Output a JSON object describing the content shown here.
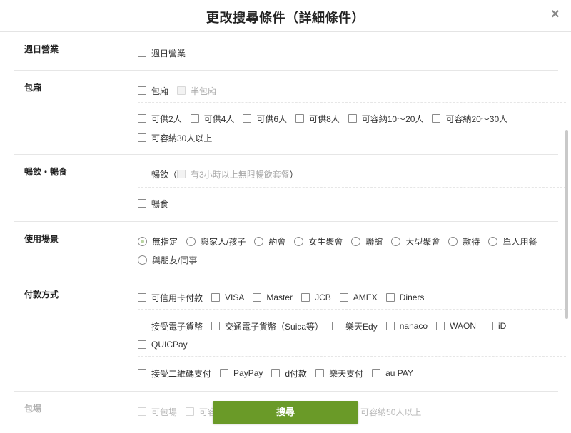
{
  "header": {
    "title": "更改搜尋條件（詳細條件）",
    "close_icon": "×"
  },
  "sections": {
    "weekday": {
      "label": "週日營業",
      "opt1": "週日營業"
    },
    "private_room": {
      "label": "包廂",
      "opt_room": "包廂",
      "opt_half": "半包廂",
      "capacity": [
        "可供2人",
        "可供4人",
        "可供6人",
        "可供8人",
        "可容納10～20人",
        "可容納20～30人"
      ],
      "capacity_more": "可容納30人以上"
    },
    "drinks": {
      "label": "暢飲・暢食",
      "opt_drink": "暢飲",
      "opt_drink_open": "（",
      "opt_drink_sub": "有3小時以上無限暢飲套餐",
      "opt_drink_close": "）",
      "opt_food": "暢食"
    },
    "scene": {
      "label": "使用場景",
      "options": [
        "無指定",
        "與家人/孩子",
        "約會",
        "女生聚會",
        "聯誼",
        "大型聚會",
        "款待",
        "單人用餐"
      ],
      "option_more": "與朋友/同事",
      "selected": "無指定"
    },
    "payment": {
      "label": "付款方式",
      "cards": [
        "可信用卡付款",
        "VISA",
        "Master",
        "JCB",
        "AMEX",
        "Diners"
      ],
      "emoney": [
        "接受電子貨幣",
        "交通電子貨幣（Suica等）",
        "樂天Edy",
        "nanaco",
        "WAON",
        "iD"
      ],
      "emoney_more": "QUICPay",
      "qr": [
        "接受二維碼支付",
        "PayPay",
        "d付款",
        "樂天支付",
        "au PAY"
      ]
    },
    "venue": {
      "label": "包場",
      "opt1": "可包場",
      "opt2": "可容",
      "opt3": "可容納50人以上"
    }
  },
  "search_button": "搜尋"
}
